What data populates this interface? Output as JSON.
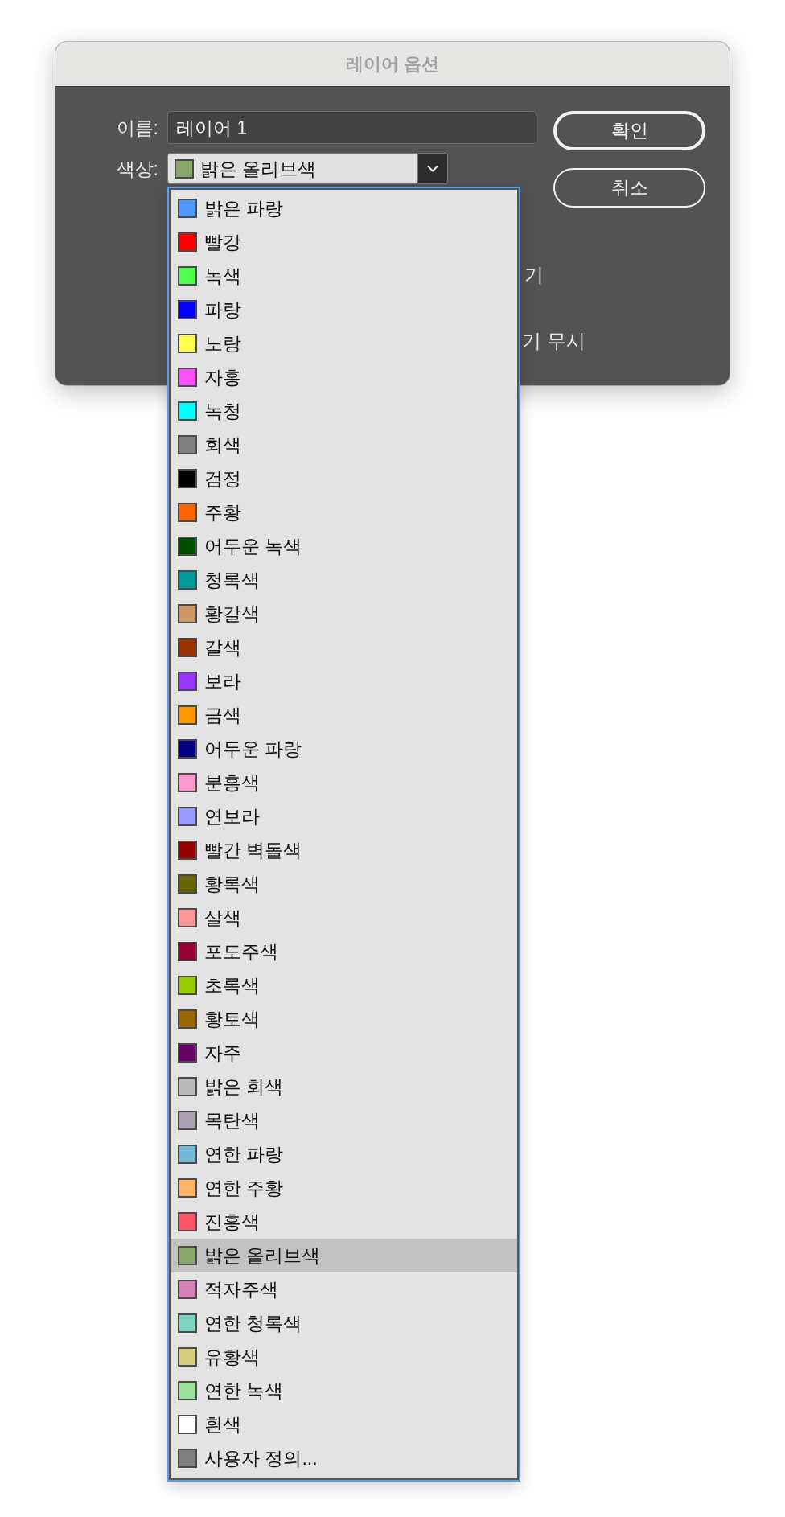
{
  "dialog": {
    "title": "레이어 옵션",
    "name_label": "이름:",
    "name_value": "레이어 1",
    "color_label": "색상:",
    "color_select": {
      "value": "밝은 올리브색",
      "color": "#8aa66a"
    },
    "buttons": [
      {
        "label": "확인",
        "default": true
      },
      {
        "label": "취소",
        "default": false
      }
    ],
    "obscured_texts": [
      "기",
      "기 무시"
    ]
  },
  "color_menu": {
    "items": [
      {
        "label": "밝은 파랑",
        "color": "#4f99ff",
        "selected": false
      },
      {
        "label": "빨강",
        "color": "#ff0000",
        "selected": false
      },
      {
        "label": "녹색",
        "color": "#4fff4f",
        "selected": false
      },
      {
        "label": "파랑",
        "color": "#0000ff",
        "selected": false
      },
      {
        "label": "노랑",
        "color": "#ffff4f",
        "selected": false
      },
      {
        "label": "자홍",
        "color": "#ff4fff",
        "selected": false
      },
      {
        "label": "녹청",
        "color": "#00ffff",
        "selected": false
      },
      {
        "label": "회색",
        "color": "#808080",
        "selected": false
      },
      {
        "label": "검정",
        "color": "#000000",
        "selected": false
      },
      {
        "label": "주황",
        "color": "#ff6600",
        "selected": false
      },
      {
        "label": "어두운 녹색",
        "color": "#004f00",
        "selected": false
      },
      {
        "label": "청록색",
        "color": "#009999",
        "selected": false
      },
      {
        "label": "황갈색",
        "color": "#cc9966",
        "selected": false
      },
      {
        "label": "갈색",
        "color": "#993300",
        "selected": false
      },
      {
        "label": "보라",
        "color": "#9933ff",
        "selected": false
      },
      {
        "label": "금색",
        "color": "#ff9900",
        "selected": false
      },
      {
        "label": "어두운 파랑",
        "color": "#000080",
        "selected": false
      },
      {
        "label": "분홍색",
        "color": "#ff99cc",
        "selected": false
      },
      {
        "label": "연보라",
        "color": "#9999ff",
        "selected": false
      },
      {
        "label": "빨간 벽돌색",
        "color": "#990000",
        "selected": false
      },
      {
        "label": "황록색",
        "color": "#666600",
        "selected": false
      },
      {
        "label": "살색",
        "color": "#ff9999",
        "selected": false
      },
      {
        "label": "포도주색",
        "color": "#990033",
        "selected": false
      },
      {
        "label": "초록색",
        "color": "#99cc00",
        "selected": false
      },
      {
        "label": "황토색",
        "color": "#996600",
        "selected": false
      },
      {
        "label": "자주",
        "color": "#660066",
        "selected": false
      },
      {
        "label": "밝은 회색",
        "color": "#bababa",
        "selected": false
      },
      {
        "label": "목탄색",
        "color": "#aaa0b4",
        "selected": false
      },
      {
        "label": "연한 파랑",
        "color": "#75b8d8",
        "selected": false
      },
      {
        "label": "연한 주황",
        "color": "#ffb366",
        "selected": false
      },
      {
        "label": "진홍색",
        "color": "#ff5566",
        "selected": false
      },
      {
        "label": "밝은 올리브색",
        "color": "#8aa66a",
        "selected": true
      },
      {
        "label": "적자주색",
        "color": "#d480b8",
        "selected": false
      },
      {
        "label": "연한 청록색",
        "color": "#80d4c4",
        "selected": false
      },
      {
        "label": "유황색",
        "color": "#d4d080",
        "selected": false
      },
      {
        "label": "연한 녹색",
        "color": "#99e099",
        "selected": false
      },
      {
        "label": "흰색",
        "color": "#ffffff",
        "selected": false
      },
      {
        "label": "사용자 정의...",
        "color": "#808080",
        "selected": false
      }
    ]
  }
}
